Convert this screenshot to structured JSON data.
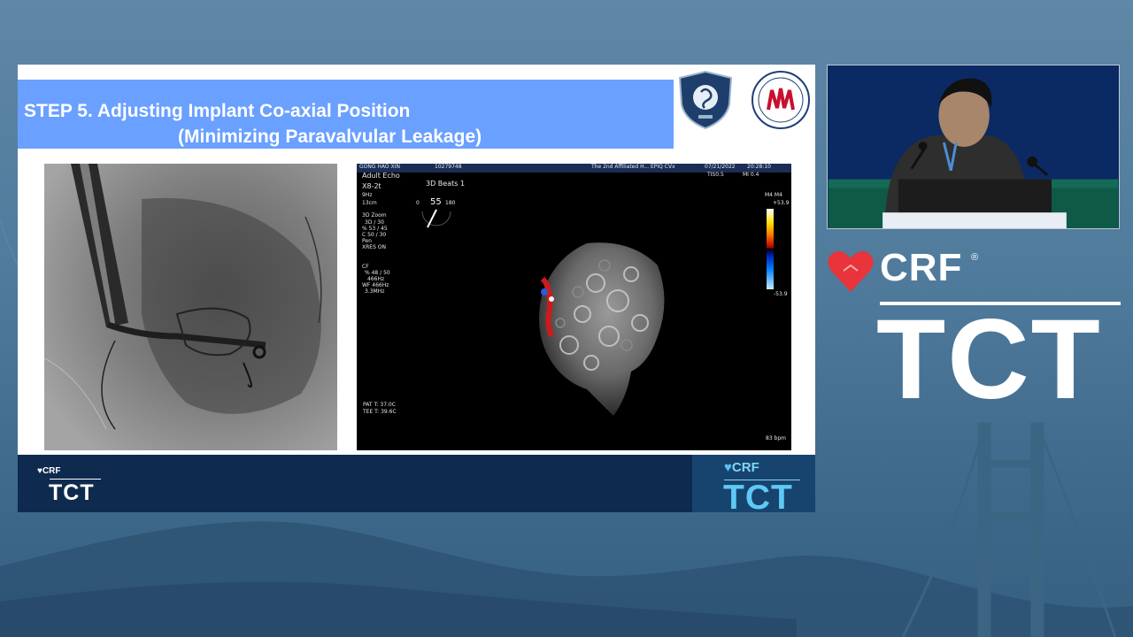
{
  "slide": {
    "title_line1": "STEP 5. Adjusting Implant Co-axial Position",
    "title_line2": "(Minimizing Paravalvular Leakage)",
    "title_bar_color": "#6aa0ff"
  },
  "echo": {
    "header": {
      "patient": "GONG HAO XIN",
      "id": "10279748",
      "hospital": "The 2nd Affiliated H...",
      "system": "EPIQ CVx",
      "date": "07/21/2022",
      "time": "20:28:10",
      "tis": "TIS0.5",
      "mi": "MI 0.4"
    },
    "mode": "Adult Echo",
    "probe": "X8-2t",
    "rate": "9Hz",
    "depth": "13cm",
    "beats": "3D Beats 1",
    "angle_min": "0",
    "angle_value": "55",
    "angle_max": "180",
    "zoom_label": "3D Zoom",
    "zoom_params": [
      "3D / 30",
      "% 53 / 45",
      "C 50 / 30",
      "Pen",
      "XRES ON"
    ],
    "cf_label": "CF",
    "cf_params": [
      "% 48 / 50",
      "466Hz",
      "WF 466Hz",
      "3.3MHz"
    ],
    "scale_top_label": "M4  M4",
    "scale_top_value": "+53.9",
    "scale_bottom_value": "-53.9",
    "pat_t": "PAT T: 37.0C",
    "tee_t": "TEE T: 39.6C",
    "heart_rate": "83 bpm"
  },
  "footer": {
    "crf_text": "CRF",
    "heart_glyph": "♥",
    "tct_text": "TCT",
    "badge_crf": "CRF",
    "badge_tct": "TCT"
  },
  "brand": {
    "crf": "CRF",
    "reg": "®",
    "tct": "TCT",
    "heart_color": "#e8343a"
  }
}
